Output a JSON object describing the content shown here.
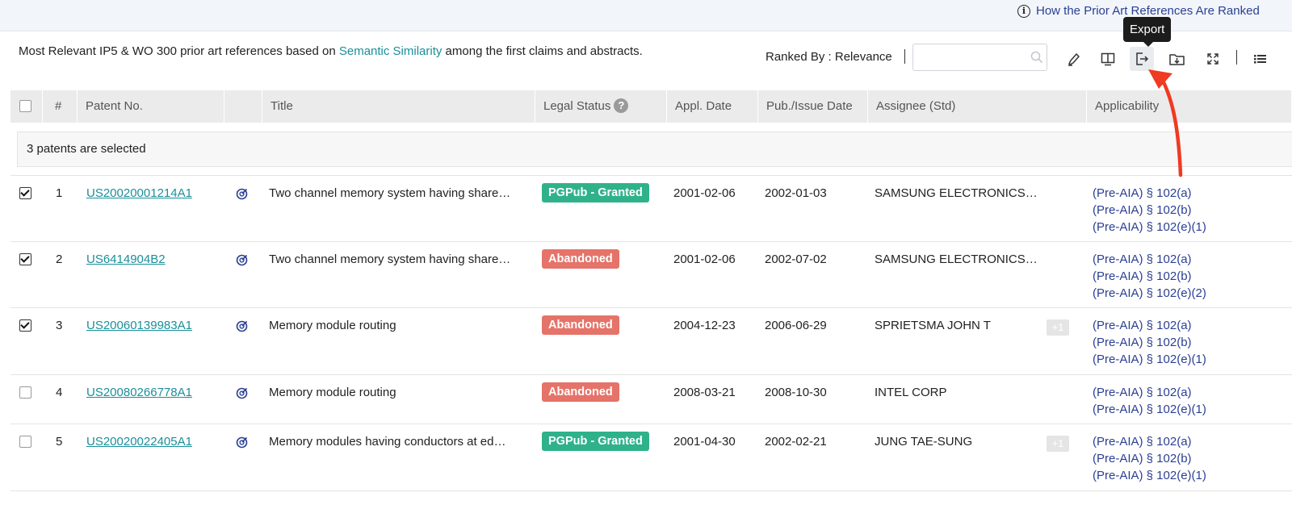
{
  "topbar": {
    "info_link": "How the Prior Art References Are Ranked"
  },
  "description": {
    "before": "Most Relevant IP5 & WO 300 prior art references based on ",
    "link": "Semantic Similarity",
    "after": " among the first claims and abstracts."
  },
  "toolbar": {
    "ranked_by": "Ranked By : Relevance",
    "search_value": "",
    "tooltip": "Export",
    "icons": [
      "highlighter-icon",
      "split-view-icon",
      "export-icon",
      "save-to-folder-icon",
      "expand-icon",
      "list-view-icon"
    ]
  },
  "table": {
    "headers": {
      "number": "#",
      "patent_no": "Patent No.",
      "title": "Title",
      "legal_status": "Legal Status",
      "help": "?",
      "appl_date": "Appl. Date",
      "pub_date": "Pub./Issue Date",
      "assignee": "Assignee (Std)",
      "applicability": "Applicability"
    },
    "selected_text": "3 patents are selected",
    "rows": [
      {
        "checked": true,
        "num": "1",
        "patent": "US20020001214A1",
        "title": "Two channel memory system having share…",
        "status": "PGPub - Granted",
        "status_type": "granted",
        "appl_date": "2001-02-06",
        "pub_date": "2002-01-03",
        "assignee": "SAMSUNG ELECTRONICS…",
        "extra": "",
        "applicability": [
          "(Pre-AIA) § 102(a)",
          "(Pre-AIA) § 102(b)",
          "(Pre-AIA) § 102(e)(1)"
        ]
      },
      {
        "checked": true,
        "num": "2",
        "patent": "US6414904B2",
        "title": "Two channel memory system having share…",
        "status": "Abandoned",
        "status_type": "abandoned",
        "appl_date": "2001-02-06",
        "pub_date": "2002-07-02",
        "assignee": "SAMSUNG ELECTRONICS…",
        "extra": "",
        "applicability": [
          "(Pre-AIA) § 102(a)",
          "(Pre-AIA) § 102(b)",
          "(Pre-AIA) § 102(e)(2)"
        ]
      },
      {
        "checked": true,
        "num": "3",
        "patent": "US20060139983A1",
        "title": "Memory module routing",
        "status": "Abandoned",
        "status_type": "abandoned",
        "appl_date": "2004-12-23",
        "pub_date": "2006-06-29",
        "assignee": "SPRIETSMA JOHN T",
        "extra": "+1",
        "applicability": [
          "(Pre-AIA) § 102(a)",
          "(Pre-AIA) § 102(b)",
          "(Pre-AIA) § 102(e)(1)"
        ]
      },
      {
        "checked": false,
        "num": "4",
        "patent": "US20080266778A1",
        "title": "Memory module routing",
        "status": "Abandoned",
        "status_type": "abandoned",
        "appl_date": "2008-03-21",
        "pub_date": "2008-10-30",
        "assignee": "INTEL CORP",
        "extra": "",
        "applicability": [
          "(Pre-AIA) § 102(a)",
          "(Pre-AIA) § 102(e)(1)"
        ]
      },
      {
        "checked": false,
        "num": "5",
        "patent": "US20020022405A1",
        "title": "Memory modules having conductors at ed…",
        "status": "PGPub - Granted",
        "status_type": "granted",
        "appl_date": "2001-04-30",
        "pub_date": "2002-02-21",
        "assignee": "JUNG TAE-SUNG",
        "extra": "+1",
        "applicability": [
          "(Pre-AIA) § 102(a)",
          "(Pre-AIA) § 102(b)",
          "(Pre-AIA) § 102(e)(1)"
        ]
      }
    ]
  },
  "colors": {
    "link_teal": "#1a8f9a",
    "link_navy": "#2a3f94",
    "granted": "#2fb28a",
    "abandoned": "#e57369",
    "annotation_arrow": "#f03a22"
  }
}
